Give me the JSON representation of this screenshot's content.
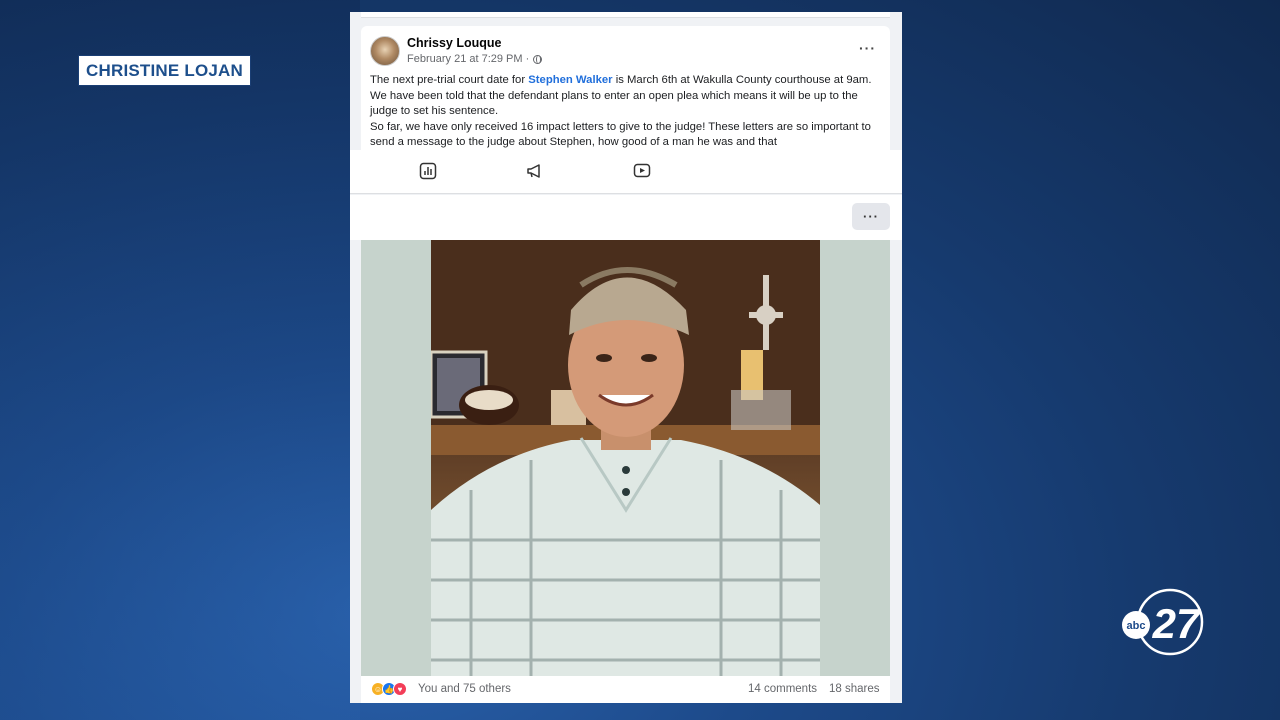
{
  "lower_third": {
    "reporter_name": "CHRISTINE LOJAN"
  },
  "post": {
    "author": "Chrissy Louque",
    "timestamp": "February 21 at 7:29 PM ·",
    "text_before_mention": "The next pre-trial court date for ",
    "mention": "Stephen Walker",
    "text_after_mention": "  is March 6th at Wakulla County courthouse at 9am. We have been told that the defendant plans to enter an open plea which means it will be up to the judge to set his sentence.",
    "text_line2": "So far, we have only received 16 impact letters to give to the judge! These letters are so important to send a message to the judge about Stephen, how good of a man he was and that",
    "more_label": "···"
  },
  "toolbar": {
    "icons": [
      "insights-icon",
      "megaphone-icon",
      "video-icon"
    ],
    "more_label": "···"
  },
  "engagement": {
    "reactions_text": "You and 75 others",
    "comments": "14 comments",
    "shares": "18 shares"
  },
  "station_logo": {
    "network": "abc",
    "channel": "27"
  },
  "colors": {
    "mention": "#216fdb",
    "name_tag_text": "#1d4f8c",
    "background": "#1d4a8a"
  }
}
